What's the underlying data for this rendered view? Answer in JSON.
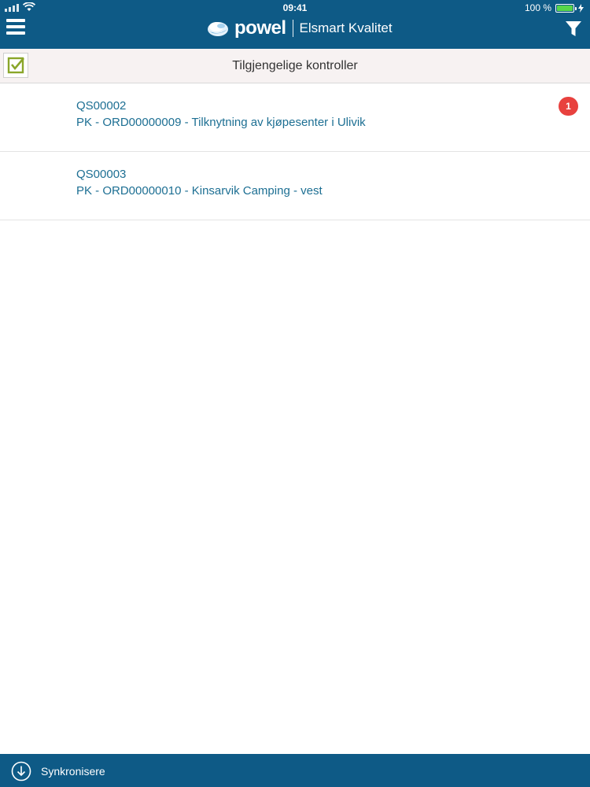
{
  "statusbar": {
    "time": "09:41",
    "battery_text": "100 %",
    "battery_level": 1.0,
    "signal_icon": "cellular-signal-icon",
    "wifi_icon": "wifi-icon",
    "charging_icon": "charging-bolt-icon"
  },
  "header": {
    "brand_name": "powel",
    "app_name": "Elsmart Kvalitet",
    "menu_icon": "hamburger-menu-icon",
    "filter_icon": "filter-funnel-icon",
    "logo_icon": "powel-cloud-logo"
  },
  "subheader": {
    "title": "Tilgjengelige kontroller",
    "check_icon": "checkbox-checked-icon"
  },
  "items": [
    {
      "id": "QS00002",
      "description": "PK - ORD00000009 - Tilknytning av kjøpesenter i Ulivik",
      "badge": "1"
    },
    {
      "id": "QS00003",
      "description": "PK - ORD00000010 - Kinsarvik Camping - vest",
      "badge": ""
    }
  ],
  "footer": {
    "sync_label": "Synkronisere",
    "sync_icon": "download-circle-icon"
  },
  "colors": {
    "primary": "#0e5a86",
    "link_text": "#1d6f93",
    "badge": "#e8413e",
    "subheader_bg": "#f7f2f2",
    "check_accent": "#8aa62a"
  }
}
